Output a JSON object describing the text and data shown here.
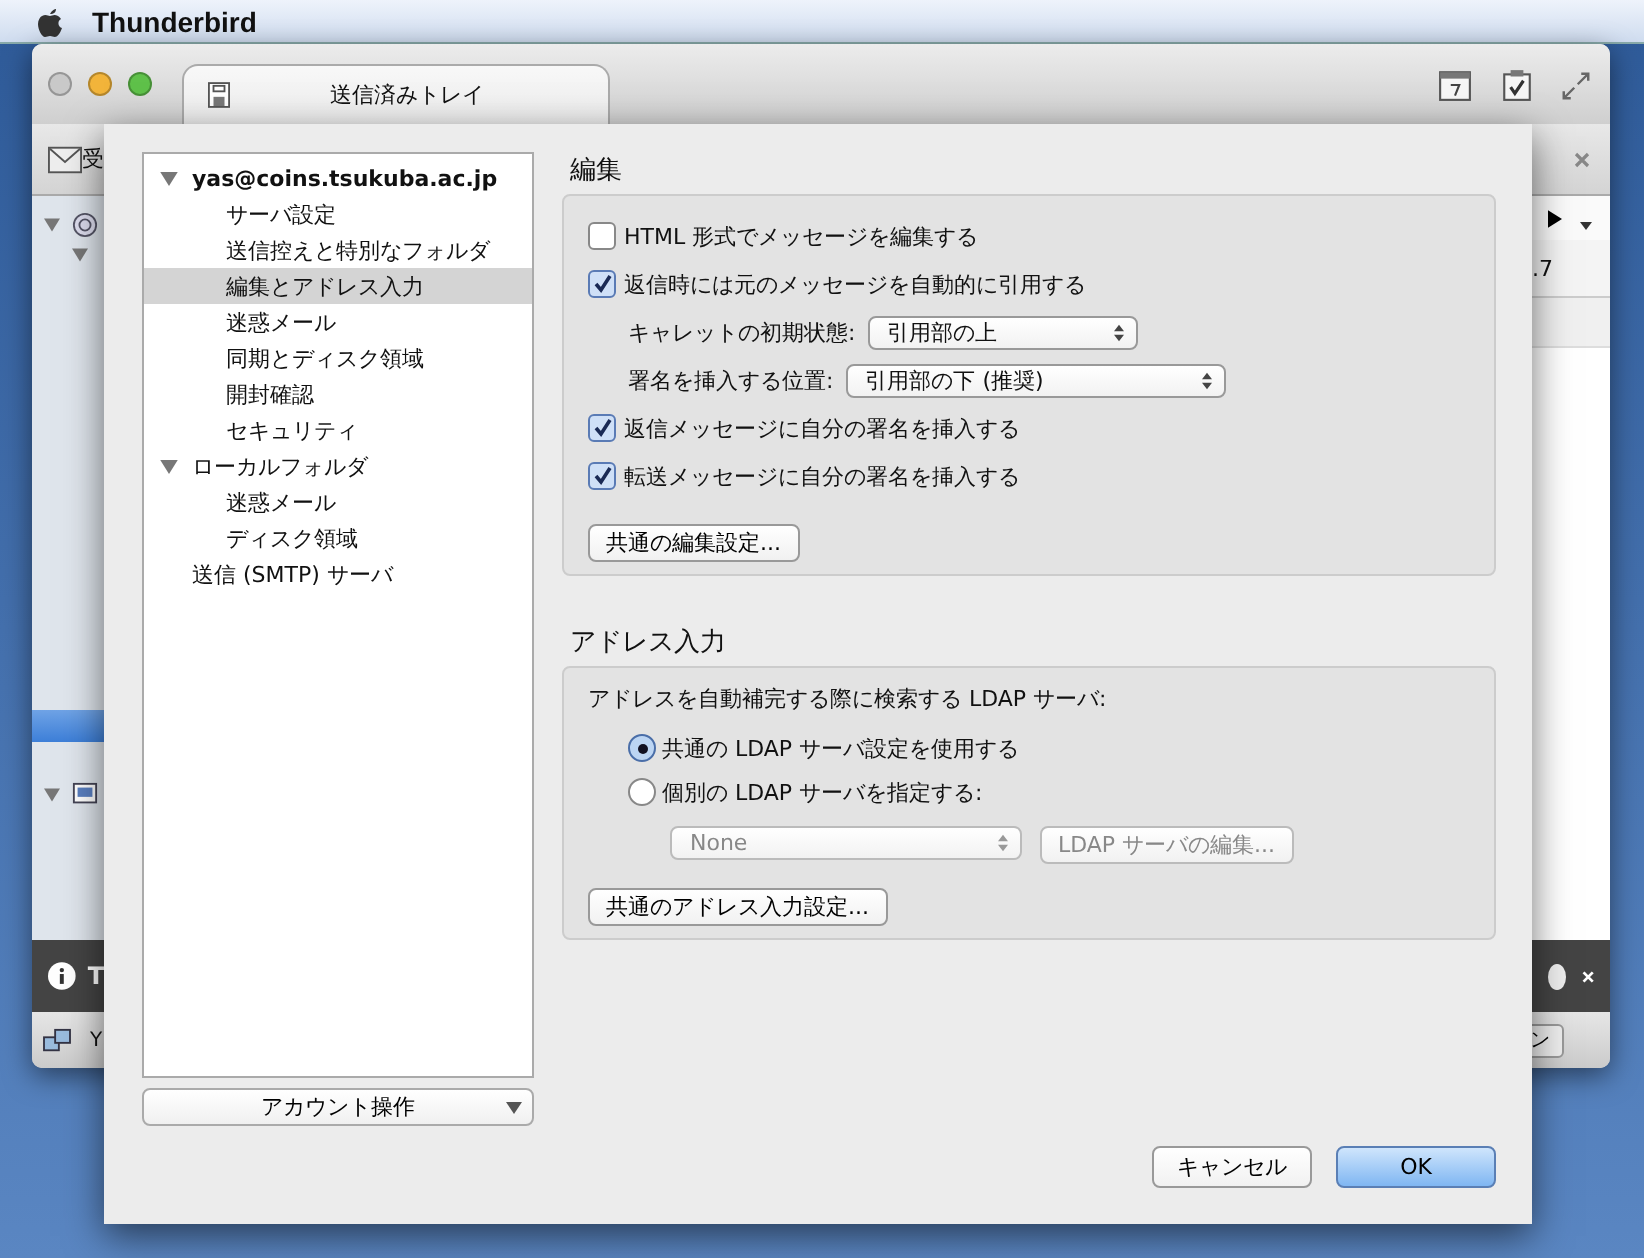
{
  "menubar": {
    "app_name": "Thunderbird"
  },
  "main_window": {
    "tab_title": "送信済みトレイ",
    "toolbar_fragment": "受",
    "row_fragment": ".7",
    "notification_fragment": "T",
    "status_fragment": "Y",
    "status_button_fragment": "ン"
  },
  "account_tree": {
    "items": [
      {
        "label": "yas@coins.tsukuba.ac.jp",
        "expanded": true,
        "selected": false,
        "children": [
          {
            "label": "サーバ設定",
            "selected": false
          },
          {
            "label": "送信控えと特別なフォルダ",
            "selected": false
          },
          {
            "label": "編集とアドレス入力",
            "selected": true
          },
          {
            "label": "迷惑メール",
            "selected": false
          },
          {
            "label": "同期とディスク領域",
            "selected": false
          },
          {
            "label": "開封確認",
            "selected": false
          },
          {
            "label": "セキュリティ",
            "selected": false
          }
        ]
      },
      {
        "label": "ローカルフォルダ",
        "expanded": true,
        "selected": false,
        "children": [
          {
            "label": "迷惑メール",
            "selected": false
          },
          {
            "label": "ディスク領域",
            "selected": false
          }
        ]
      },
      {
        "label": "送信 (SMTP) サーバ",
        "selected": false
      }
    ]
  },
  "account_actions": "アカウント操作",
  "editing": {
    "title": "編集",
    "options": [
      {
        "kind": "checkbox",
        "label": "HTML 形式でメッセージを編集する",
        "checked": false
      },
      {
        "kind": "checkbox",
        "label": "返信時には元のメッセージを自動的に引用する",
        "checked": true
      },
      {
        "kind": "select",
        "label": "キャレットの初期状態:",
        "value": "引用部の上"
      },
      {
        "kind": "select",
        "label": "署名を挿入する位置:",
        "value": "引用部の下 (推奨)"
      },
      {
        "kind": "checkbox",
        "label": "返信メッセージに自分の署名を挿入する",
        "checked": true
      },
      {
        "kind": "checkbox",
        "label": "転送メッセージに自分の署名を挿入する",
        "checked": true
      }
    ],
    "button": "共通の編集設定..."
  },
  "addressing": {
    "title": "アドレス入力",
    "prompt": "アドレスを自動補完する際に検索する LDAP サーバ:",
    "radios": [
      {
        "label": "共通の LDAP サーバ設定を使用する",
        "selected": true
      },
      {
        "label": "個別の LDAP サーバを指定する:",
        "selected": false
      }
    ],
    "server_select": {
      "value": "None",
      "disabled": true
    },
    "edit_button": {
      "label": "LDAP サーバの編集...",
      "disabled": true
    },
    "button": "共通のアドレス入力設定..."
  },
  "footer": {
    "cancel": "キャンセル",
    "ok": "OK"
  }
}
